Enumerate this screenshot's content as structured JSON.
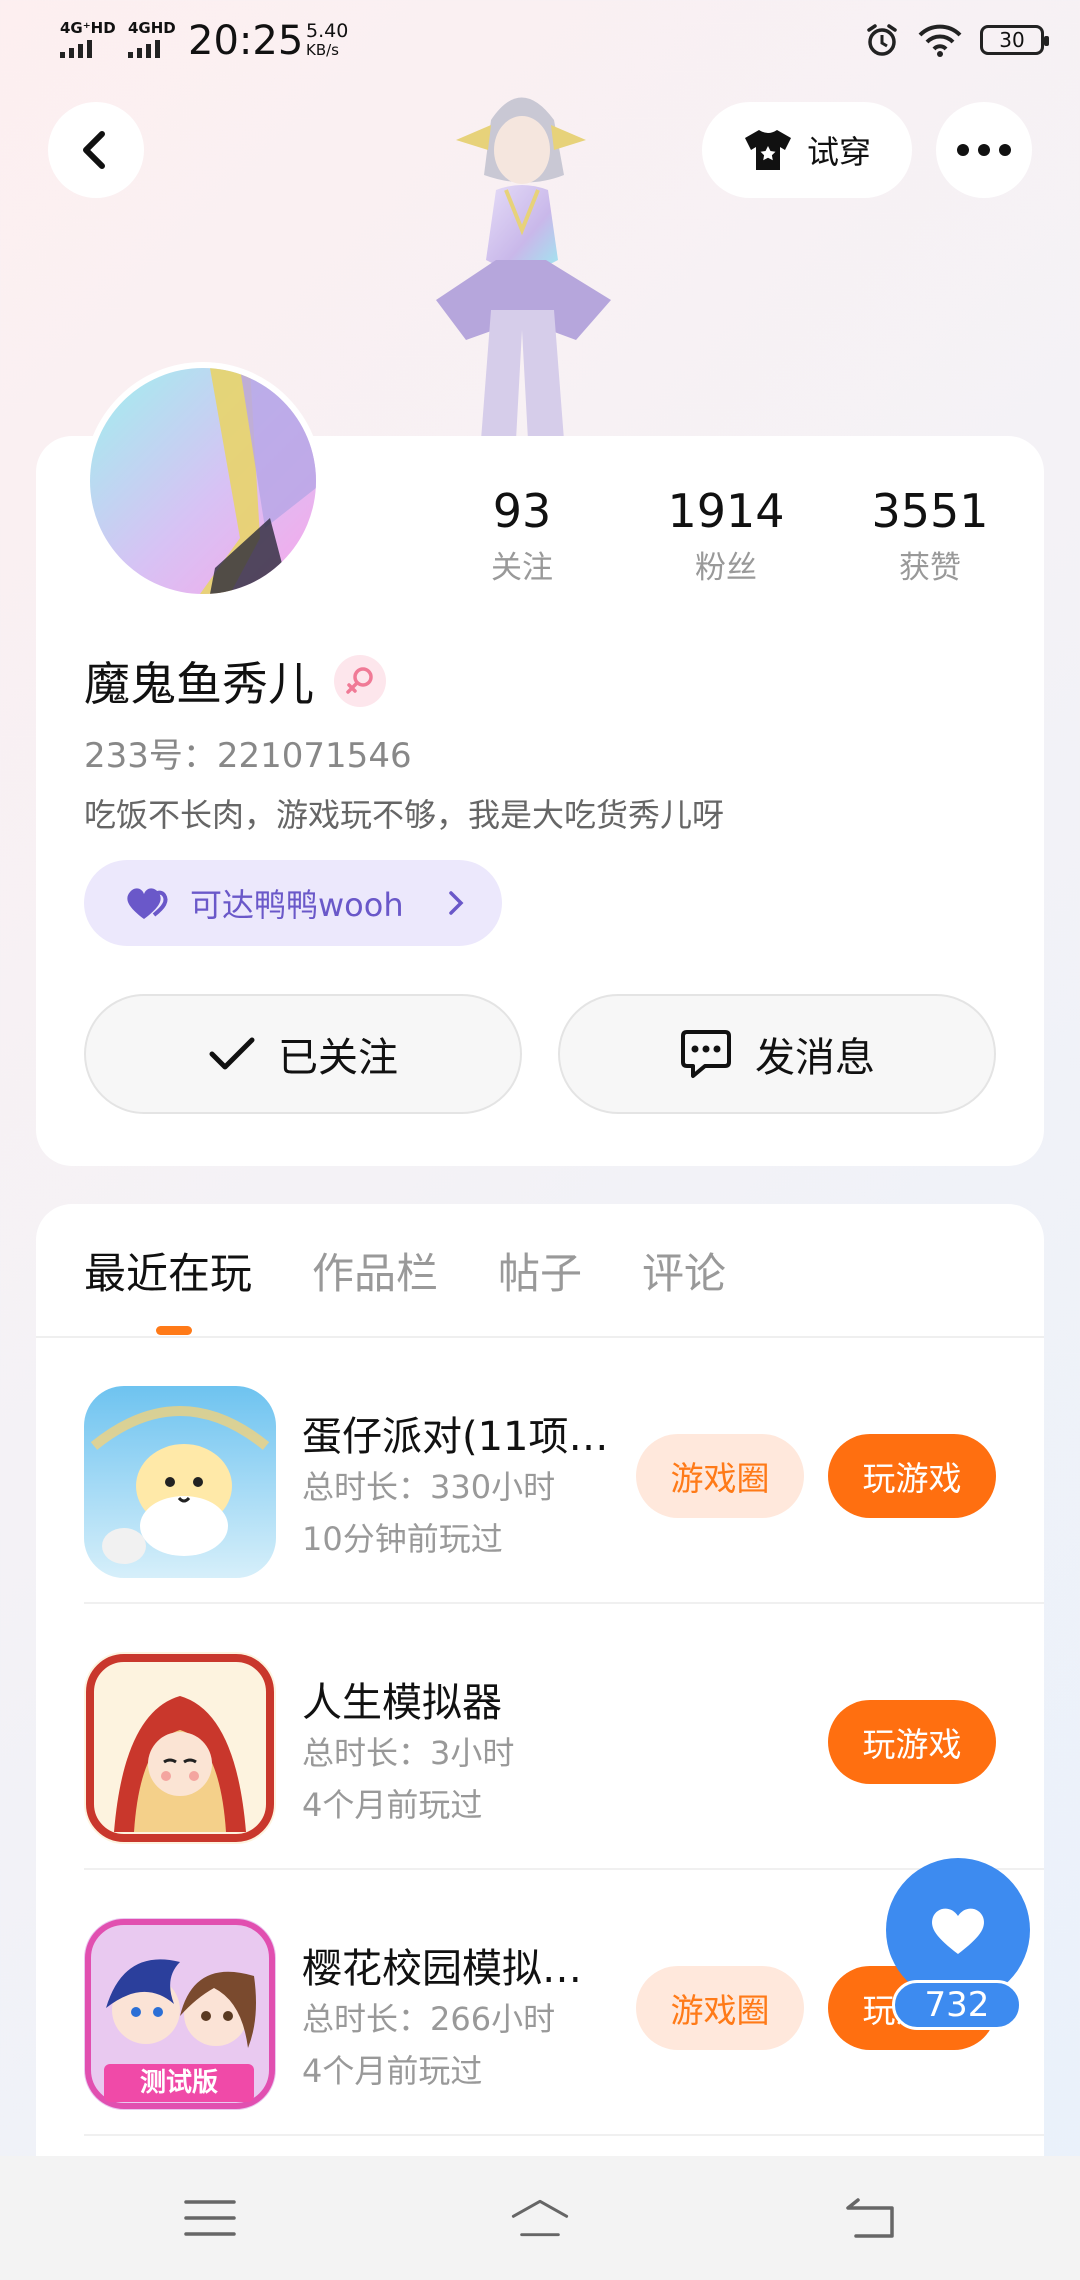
{
  "status_bar": {
    "sim1": "4G⁺HD",
    "sim2": "4GHD",
    "time": "20:25",
    "speed_value": "5.40",
    "speed_unit": "KB/s",
    "battery": "30"
  },
  "header": {
    "try_on_label": "试穿"
  },
  "profile": {
    "stats": [
      {
        "value": "93",
        "label": "关注"
      },
      {
        "value": "1914",
        "label": "粉丝"
      },
      {
        "value": "3551",
        "label": "获赞"
      }
    ],
    "name": "魔鬼鱼秀儿",
    "uid": "233号：221071546",
    "bio": "吃饭不长肉，游戏玩不够，我是大吃货秀儿呀",
    "tag": "可达鸭鸭wooh",
    "follow_label": "已关注",
    "message_label": "发消息"
  },
  "tabs": [
    "最近在玩",
    "作品栏",
    "帖子",
    "评论"
  ],
  "games": [
    {
      "title": "蛋仔派对(11项…",
      "duration": "总时长：330小时",
      "last_played": "10分钟前玩过",
      "circle_label": "游戏圈",
      "play_label": "玩游戏"
    },
    {
      "title": "人生模拟器",
      "duration": "总时长：3小时",
      "last_played": "4个月前玩过",
      "play_label": "玩游戏"
    },
    {
      "title": "樱花校园模拟…",
      "duration": "总时长：266小时",
      "last_played": "4个月前玩过",
      "circle_label": "游戏圈",
      "play_label": "玩游戏",
      "icon_badge": "测试版"
    }
  ],
  "like": {
    "count": "732"
  },
  "colors": {
    "accent": "#ff6f10",
    "like_blue": "#3d8bf0",
    "tag_purple": "#6a58c9"
  }
}
